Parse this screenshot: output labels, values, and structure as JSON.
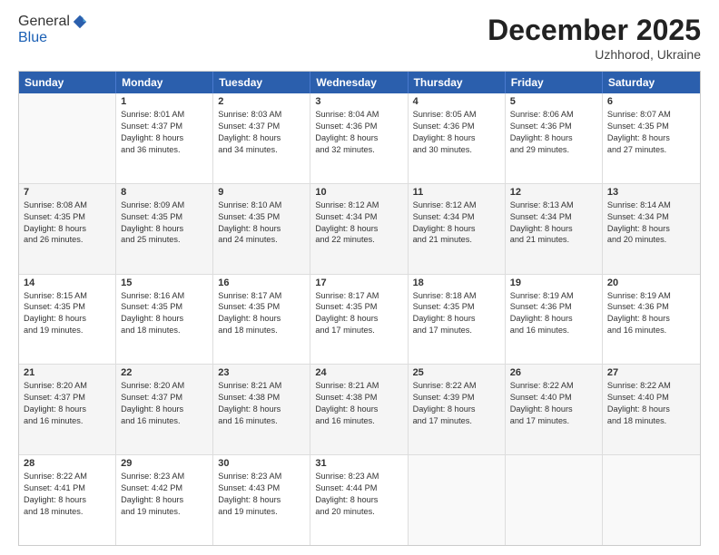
{
  "header": {
    "logo_line1": "General",
    "logo_line2": "Blue",
    "month_year": "December 2025",
    "location": "Uzhhorod, Ukraine"
  },
  "weekdays": [
    "Sunday",
    "Monday",
    "Tuesday",
    "Wednesday",
    "Thursday",
    "Friday",
    "Saturday"
  ],
  "rows": [
    [
      {
        "day": "",
        "lines": [],
        "empty": true
      },
      {
        "day": "1",
        "lines": [
          "Sunrise: 8:01 AM",
          "Sunset: 4:37 PM",
          "Daylight: 8 hours",
          "and 36 minutes."
        ]
      },
      {
        "day": "2",
        "lines": [
          "Sunrise: 8:03 AM",
          "Sunset: 4:37 PM",
          "Daylight: 8 hours",
          "and 34 minutes."
        ]
      },
      {
        "day": "3",
        "lines": [
          "Sunrise: 8:04 AM",
          "Sunset: 4:36 PM",
          "Daylight: 8 hours",
          "and 32 minutes."
        ]
      },
      {
        "day": "4",
        "lines": [
          "Sunrise: 8:05 AM",
          "Sunset: 4:36 PM",
          "Daylight: 8 hours",
          "and 30 minutes."
        ]
      },
      {
        "day": "5",
        "lines": [
          "Sunrise: 8:06 AM",
          "Sunset: 4:36 PM",
          "Daylight: 8 hours",
          "and 29 minutes."
        ]
      },
      {
        "day": "6",
        "lines": [
          "Sunrise: 8:07 AM",
          "Sunset: 4:35 PM",
          "Daylight: 8 hours",
          "and 27 minutes."
        ]
      }
    ],
    [
      {
        "day": "7",
        "lines": [
          "Sunrise: 8:08 AM",
          "Sunset: 4:35 PM",
          "Daylight: 8 hours",
          "and 26 minutes."
        ]
      },
      {
        "day": "8",
        "lines": [
          "Sunrise: 8:09 AM",
          "Sunset: 4:35 PM",
          "Daylight: 8 hours",
          "and 25 minutes."
        ]
      },
      {
        "day": "9",
        "lines": [
          "Sunrise: 8:10 AM",
          "Sunset: 4:35 PM",
          "Daylight: 8 hours",
          "and 24 minutes."
        ]
      },
      {
        "day": "10",
        "lines": [
          "Sunrise: 8:12 AM",
          "Sunset: 4:34 PM",
          "Daylight: 8 hours",
          "and 22 minutes."
        ]
      },
      {
        "day": "11",
        "lines": [
          "Sunrise: 8:12 AM",
          "Sunset: 4:34 PM",
          "Daylight: 8 hours",
          "and 21 minutes."
        ]
      },
      {
        "day": "12",
        "lines": [
          "Sunrise: 8:13 AM",
          "Sunset: 4:34 PM",
          "Daylight: 8 hours",
          "and 21 minutes."
        ]
      },
      {
        "day": "13",
        "lines": [
          "Sunrise: 8:14 AM",
          "Sunset: 4:34 PM",
          "Daylight: 8 hours",
          "and 20 minutes."
        ]
      }
    ],
    [
      {
        "day": "14",
        "lines": [
          "Sunrise: 8:15 AM",
          "Sunset: 4:35 PM",
          "Daylight: 8 hours",
          "and 19 minutes."
        ]
      },
      {
        "day": "15",
        "lines": [
          "Sunrise: 8:16 AM",
          "Sunset: 4:35 PM",
          "Daylight: 8 hours",
          "and 18 minutes."
        ]
      },
      {
        "day": "16",
        "lines": [
          "Sunrise: 8:17 AM",
          "Sunset: 4:35 PM",
          "Daylight: 8 hours",
          "and 18 minutes."
        ]
      },
      {
        "day": "17",
        "lines": [
          "Sunrise: 8:17 AM",
          "Sunset: 4:35 PM",
          "Daylight: 8 hours",
          "and 17 minutes."
        ]
      },
      {
        "day": "18",
        "lines": [
          "Sunrise: 8:18 AM",
          "Sunset: 4:35 PM",
          "Daylight: 8 hours",
          "and 17 minutes."
        ]
      },
      {
        "day": "19",
        "lines": [
          "Sunrise: 8:19 AM",
          "Sunset: 4:36 PM",
          "Daylight: 8 hours",
          "and 16 minutes."
        ]
      },
      {
        "day": "20",
        "lines": [
          "Sunrise: 8:19 AM",
          "Sunset: 4:36 PM",
          "Daylight: 8 hours",
          "and 16 minutes."
        ]
      }
    ],
    [
      {
        "day": "21",
        "lines": [
          "Sunrise: 8:20 AM",
          "Sunset: 4:37 PM",
          "Daylight: 8 hours",
          "and 16 minutes."
        ]
      },
      {
        "day": "22",
        "lines": [
          "Sunrise: 8:20 AM",
          "Sunset: 4:37 PM",
          "Daylight: 8 hours",
          "and 16 minutes."
        ]
      },
      {
        "day": "23",
        "lines": [
          "Sunrise: 8:21 AM",
          "Sunset: 4:38 PM",
          "Daylight: 8 hours",
          "and 16 minutes."
        ]
      },
      {
        "day": "24",
        "lines": [
          "Sunrise: 8:21 AM",
          "Sunset: 4:38 PM",
          "Daylight: 8 hours",
          "and 16 minutes."
        ]
      },
      {
        "day": "25",
        "lines": [
          "Sunrise: 8:22 AM",
          "Sunset: 4:39 PM",
          "Daylight: 8 hours",
          "and 17 minutes."
        ]
      },
      {
        "day": "26",
        "lines": [
          "Sunrise: 8:22 AM",
          "Sunset: 4:40 PM",
          "Daylight: 8 hours",
          "and 17 minutes."
        ]
      },
      {
        "day": "27",
        "lines": [
          "Sunrise: 8:22 AM",
          "Sunset: 4:40 PM",
          "Daylight: 8 hours",
          "and 18 minutes."
        ]
      }
    ],
    [
      {
        "day": "28",
        "lines": [
          "Sunrise: 8:22 AM",
          "Sunset: 4:41 PM",
          "Daylight: 8 hours",
          "and 18 minutes."
        ]
      },
      {
        "day": "29",
        "lines": [
          "Sunrise: 8:23 AM",
          "Sunset: 4:42 PM",
          "Daylight: 8 hours",
          "and 19 minutes."
        ]
      },
      {
        "day": "30",
        "lines": [
          "Sunrise: 8:23 AM",
          "Sunset: 4:43 PM",
          "Daylight: 8 hours",
          "and 19 minutes."
        ]
      },
      {
        "day": "31",
        "lines": [
          "Sunrise: 8:23 AM",
          "Sunset: 4:44 PM",
          "Daylight: 8 hours",
          "and 20 minutes."
        ]
      },
      {
        "day": "",
        "lines": [],
        "empty": true
      },
      {
        "day": "",
        "lines": [],
        "empty": true
      },
      {
        "day": "",
        "lines": [],
        "empty": true
      }
    ]
  ]
}
